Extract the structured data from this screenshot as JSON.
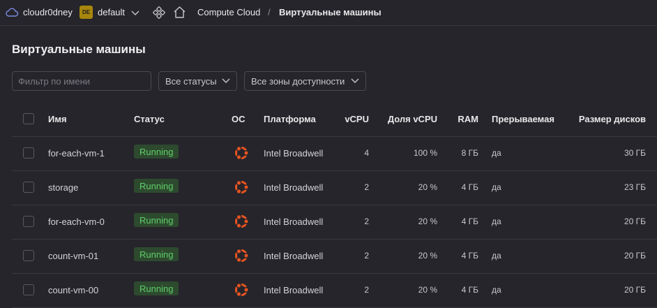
{
  "topbar": {
    "cloud_name": "cloudr0dney",
    "folder_badge": "DE",
    "folder_name": "default",
    "breadcrumb_service": "Compute Cloud",
    "breadcrumb_sep": "/",
    "breadcrumb_current": "Виртуальные машины"
  },
  "page": {
    "title": "Виртуальные машины"
  },
  "filters": {
    "name_placeholder": "Фильтр по имени",
    "status_select": "Все статусы",
    "zone_select": "Все зоны доступности"
  },
  "table": {
    "columns": {
      "name": "Имя",
      "status": "Статус",
      "os": "ОС",
      "platform": "Платформа",
      "vcpu": "vCPU",
      "vcpu_share": "Доля vCPU",
      "ram": "RAM",
      "preemptible": "Прерываемая",
      "disk_size": "Размер дисков"
    },
    "rows": [
      {
        "name": "for-each-vm-1",
        "status": "Running",
        "os_icon": "ubuntu-icon",
        "platform": "Intel Broadwell",
        "vcpu": "4",
        "vcpu_share": "100 %",
        "ram": "8 ГБ",
        "preemptible": "да",
        "disk_size": "30 ГБ"
      },
      {
        "name": "storage",
        "status": "Running",
        "os_icon": "ubuntu-icon",
        "platform": "Intel Broadwell",
        "vcpu": "2",
        "vcpu_share": "20 %",
        "ram": "4 ГБ",
        "preemptible": "да",
        "disk_size": "23 ГБ"
      },
      {
        "name": "for-each-vm-0",
        "status": "Running",
        "os_icon": "ubuntu-icon",
        "platform": "Intel Broadwell",
        "vcpu": "2",
        "vcpu_share": "20 %",
        "ram": "4 ГБ",
        "preemptible": "да",
        "disk_size": "20 ГБ"
      },
      {
        "name": "count-vm-01",
        "status": "Running",
        "os_icon": "ubuntu-icon",
        "platform": "Intel Broadwell",
        "vcpu": "2",
        "vcpu_share": "20 %",
        "ram": "4 ГБ",
        "preemptible": "да",
        "disk_size": "20 ГБ"
      },
      {
        "name": "count-vm-00",
        "status": "Running",
        "os_icon": "ubuntu-icon",
        "platform": "Intel Broadwell",
        "vcpu": "2",
        "vcpu_share": "20 %",
        "ram": "4 ГБ",
        "preemptible": "да",
        "disk_size": "20 ГБ"
      }
    ]
  },
  "colors": {
    "background": "#26252b",
    "status_running_text": "#5fcf67",
    "status_running_bg": "#2d4a2f",
    "ubuntu_orange": "#e95420",
    "folder_badge": "#a8860c"
  }
}
